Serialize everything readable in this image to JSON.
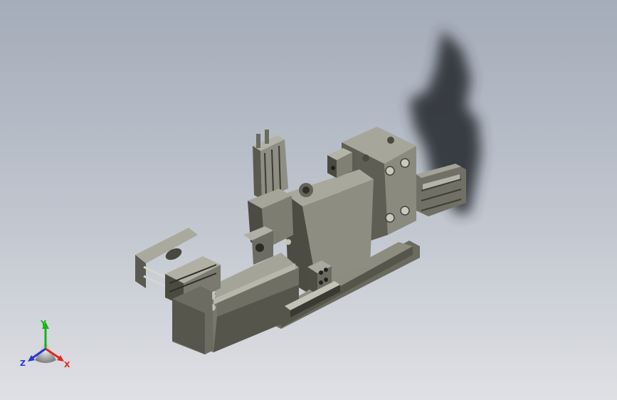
{
  "view": {
    "background_top": "#a4acb9",
    "background_bottom": "#dfe0e4",
    "model_color": "#7a7a6e"
  },
  "triad": {
    "x_label": "X",
    "y_label": "Y",
    "z_label": "Z",
    "x_color": "#e0261e",
    "y_color": "#17b21f",
    "z_color": "#2438d6"
  }
}
